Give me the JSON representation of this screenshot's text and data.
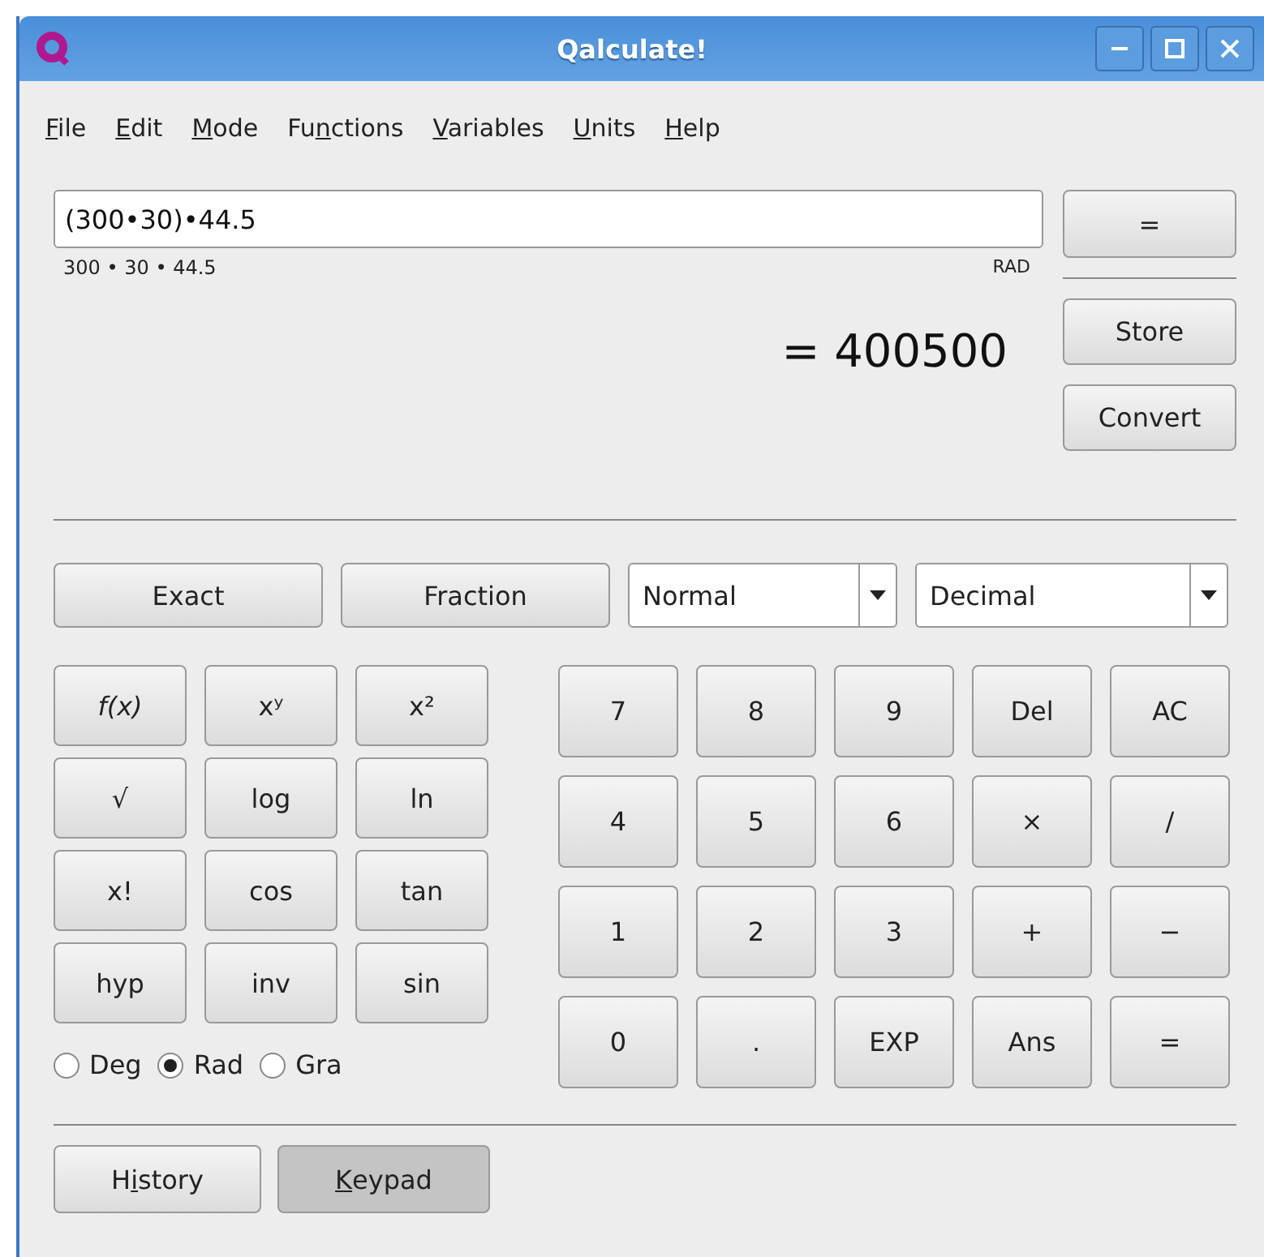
{
  "window": {
    "title": "Qalculate!"
  },
  "menu": [
    {
      "key": "F",
      "rest": "ile"
    },
    {
      "key": "E",
      "rest": "dit"
    },
    {
      "key": "M",
      "rest": "ode"
    },
    {
      "lead": "Fu",
      "key": "n",
      "rest": "ctions"
    },
    {
      "key": "V",
      "rest": "ariables"
    },
    {
      "key": "U",
      "rest": "nits"
    },
    {
      "key": "H",
      "rest": "elp"
    }
  ],
  "expression": {
    "value": "(300•30)•44.5"
  },
  "parsed": "300 • 30 • 44.5",
  "angle_indicator": "RAD",
  "result": "= 400500",
  "side_buttons": [
    "=",
    "Store",
    "Convert"
  ],
  "mode_buttons": [
    "Exact",
    "Fraction"
  ],
  "selects": [
    {
      "value": "Normal"
    },
    {
      "value": "Decimal"
    }
  ],
  "function_keys": [
    {
      "label": "f(x)",
      "italic": true
    },
    {
      "label": "xʸ"
    },
    {
      "label": "x²"
    },
    {
      "label": "√"
    },
    {
      "label": "log"
    },
    {
      "label": "ln"
    },
    {
      "label": "x!"
    },
    {
      "label": "cos"
    },
    {
      "label": "tan"
    },
    {
      "label": "hyp"
    },
    {
      "label": "inv"
    },
    {
      "label": "sin"
    }
  ],
  "angle_units": [
    {
      "label": "Deg",
      "selected": false
    },
    {
      "label": "Rad",
      "selected": true
    },
    {
      "label": "Gra",
      "selected": false
    }
  ],
  "keypad": [
    "7",
    "8",
    "9",
    "Del",
    "AC",
    "4",
    "5",
    "6",
    "×",
    "/",
    "1",
    "2",
    "3",
    "+",
    "−",
    "0",
    ".",
    "EXP",
    "Ans",
    "="
  ],
  "bottom_buttons": [
    {
      "lead": "H",
      "key": "i",
      "rest": "story",
      "pressed": false
    },
    {
      "key": "K",
      "rest": "eypad",
      "pressed": true
    }
  ]
}
